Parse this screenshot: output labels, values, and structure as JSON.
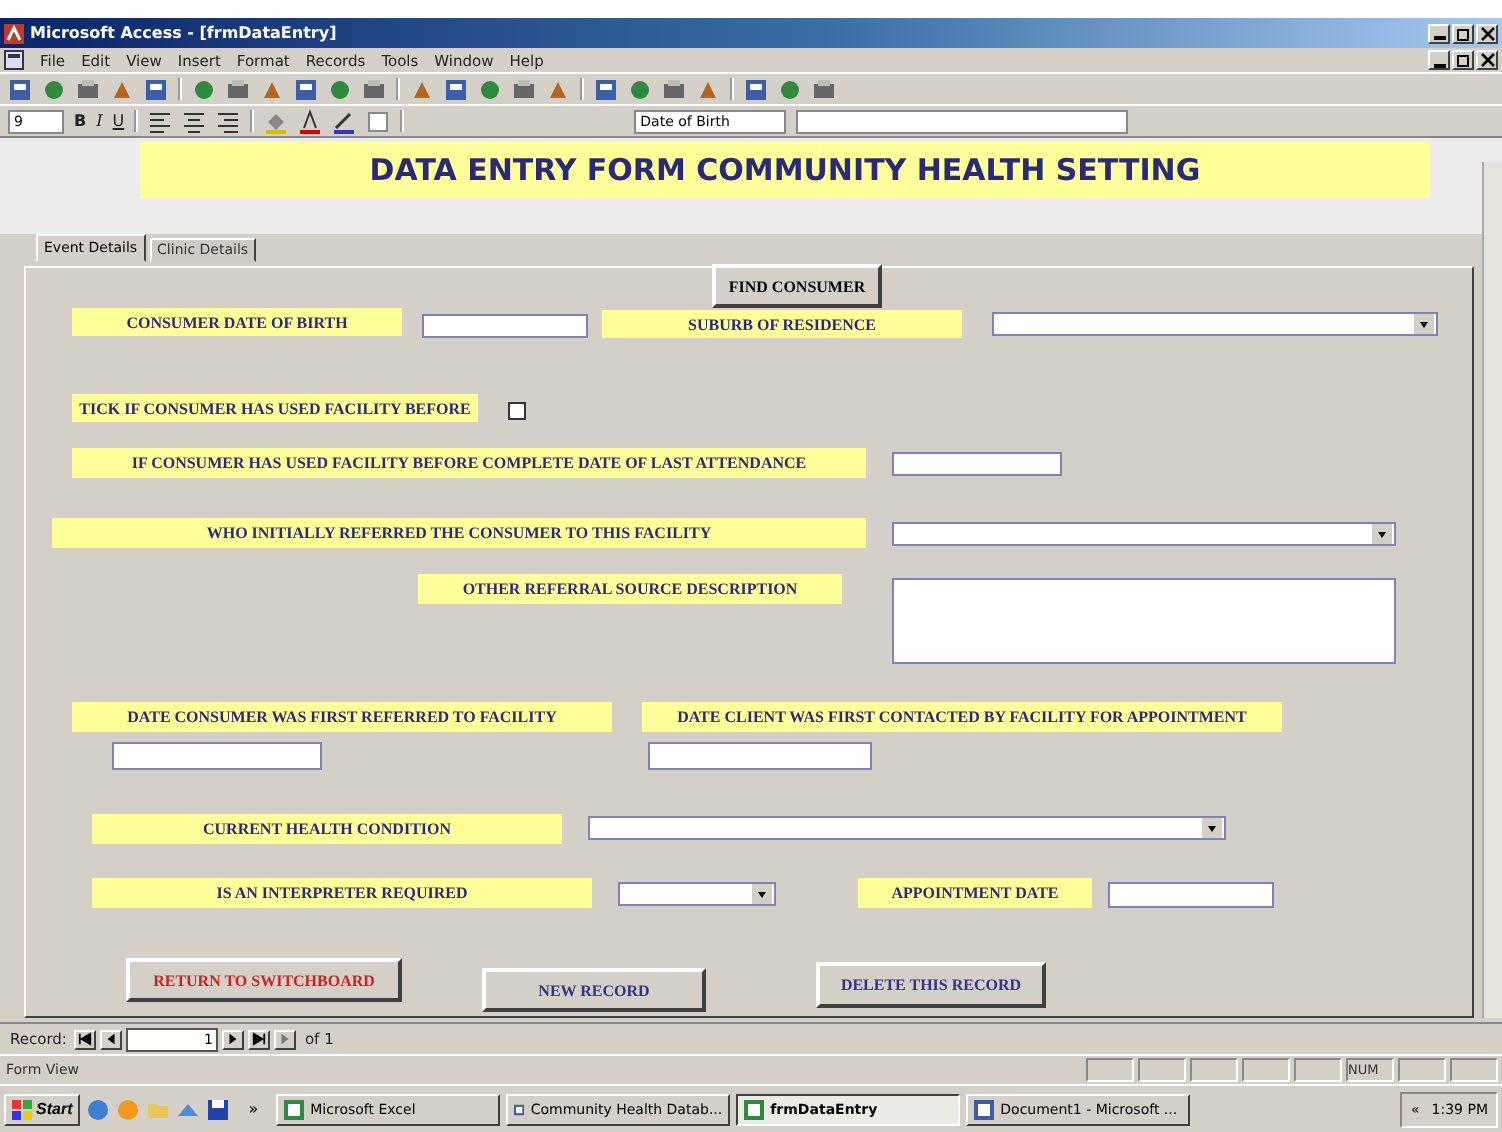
{
  "window": {
    "title": "Microsoft Access - [frmDataEntry]"
  },
  "menu": [
    "File",
    "Edit",
    "View",
    "Insert",
    "Format",
    "Records",
    "Tools",
    "Window",
    "Help"
  ],
  "format_toolbar": {
    "font_size": "9",
    "bold": "B",
    "italic": "I",
    "underline": "U",
    "object": "Date of Birth"
  },
  "form": {
    "title": "DATA ENTRY FORM COMMUNITY HEALTH SETTING",
    "tabs": [
      {
        "label": "Event Details",
        "selected": true
      },
      {
        "label": "Clinic Details",
        "selected": false
      }
    ],
    "controls": [
      {
        "kind": "button",
        "text": "FIND CONSUMER"
      },
      {
        "kind": "label",
        "text": "CONSUMER DATE OF BIRTH"
      },
      {
        "kind": "text"
      },
      {
        "kind": "label",
        "text": "SUBURB OF RESIDENCE"
      },
      {
        "kind": "combo"
      },
      {
        "kind": "label",
        "text": "TICK IF CONSUMER HAS USED FACILITY BEFORE"
      },
      {
        "kind": "checkbox",
        "checked": false
      },
      {
        "kind": "label",
        "text": "IF CONSUMER HAS USED FACILITY BEFORE COMPLETE DATE OF LAST ATTENDANCE"
      },
      {
        "kind": "text"
      },
      {
        "kind": "label",
        "text": "WHO INITIALLY REFERRED THE CONSUMER TO THIS FACILITY"
      },
      {
        "kind": "combo"
      },
      {
        "kind": "label",
        "text": "OTHER REFERRAL SOURCE DESCRIPTION"
      },
      {
        "kind": "memo"
      },
      {
        "kind": "label",
        "text": "DATE CONSUMER WAS FIRST REFERRED TO FACILITY"
      },
      {
        "kind": "text"
      },
      {
        "kind": "label",
        "text": "DATE CLIENT WAS FIRST CONTACTED BY FACILITY FOR APPOINTMENT"
      },
      {
        "kind": "text"
      },
      {
        "kind": "label",
        "text": "CURRENT HEALTH CONDITION"
      },
      {
        "kind": "combo"
      },
      {
        "kind": "label",
        "text": "IS AN INTERPRETER REQUIRED"
      },
      {
        "kind": "combo"
      },
      {
        "kind": "label",
        "text": "APPOINTMENT DATE"
      },
      {
        "kind": "text"
      },
      {
        "kind": "button",
        "text": "RETURN TO SWITCHBOARD",
        "color": "#cc2222"
      },
      {
        "kind": "button",
        "text": "NEW RECORD",
        "color": "#33338a"
      },
      {
        "kind": "button",
        "text": "DELETE THIS RECORD",
        "color": "#33338a"
      }
    ]
  },
  "record_nav": {
    "label": "Record:",
    "current": "1",
    "total": "of 1"
  },
  "status_bar": {
    "text": "Form View",
    "num": "NUM"
  },
  "taskbar": {
    "start": "Start",
    "more": "»",
    "tasks": [
      {
        "label": "Microsoft Excel",
        "selected": false
      },
      {
        "label": "Community Health Datab...",
        "selected": false
      },
      {
        "label": "frmDataEntry",
        "selected": true
      },
      {
        "label": "Document1 - Microsoft ...",
        "selected": false
      }
    ],
    "tray_arrow": "«",
    "clock": "1:39 PM"
  }
}
